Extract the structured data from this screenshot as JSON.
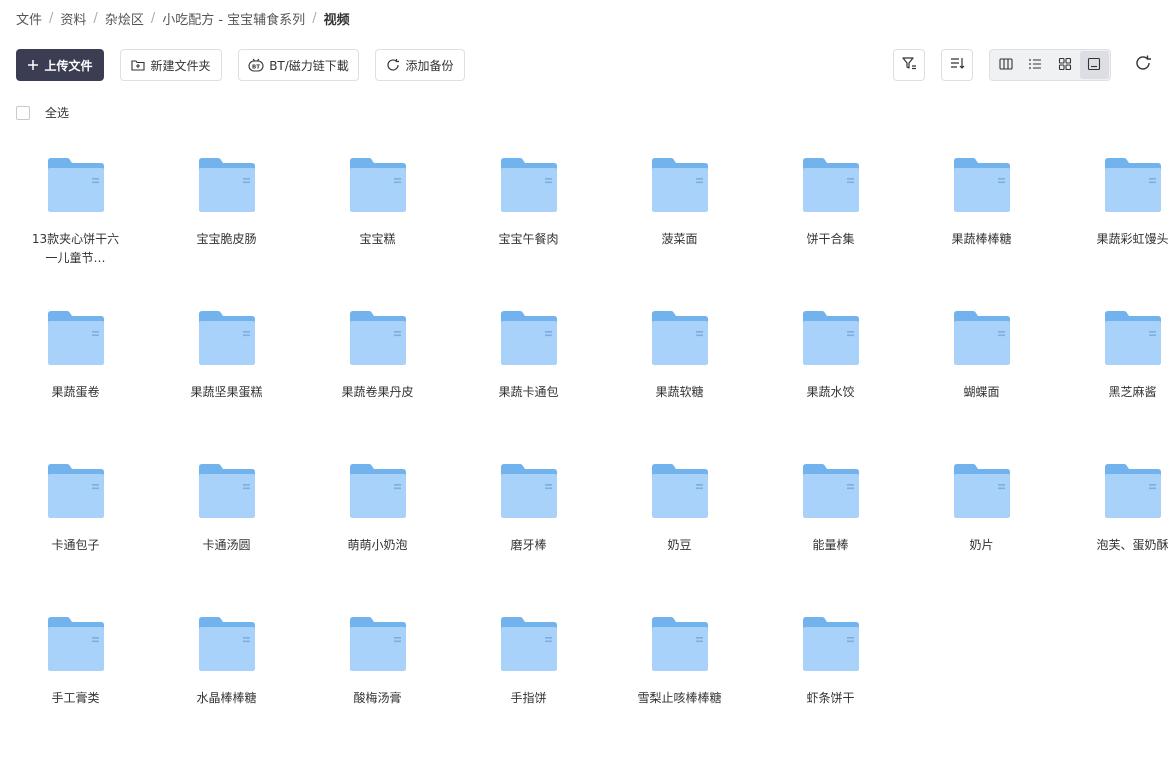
{
  "breadcrumb": [
    "文件",
    "资料",
    "杂烩区",
    "小吃配方 - 宝宝辅食系列",
    "视频"
  ],
  "toolbar": {
    "upload": "上传文件",
    "new_folder": "新建文件夹",
    "bt_download": "BT/磁力链下載",
    "add_backup": "添加备份"
  },
  "select_all": "全选",
  "colors": {
    "primary_button": "#3b3d52",
    "folder_back": "#72b3ee",
    "folder_front": "#a8d2f9",
    "folder_mark": "#7eaee0"
  },
  "icons": [
    "plus-icon",
    "new-folder-icon",
    "bt-icon",
    "refresh-icon",
    "filter-icon",
    "sort-icon",
    "column-view-icon",
    "list-view-icon",
    "grid-view-icon",
    "large-view-icon",
    "reload-icon",
    "folder-icon"
  ],
  "folders": [
    "13款夹心饼干六一儿童节…",
    "宝宝脆皮肠",
    "宝宝糕",
    "宝宝午餐肉",
    "菠菜面",
    "饼干合集",
    "果蔬棒棒糖",
    "果蔬彩虹馒头",
    "果蔬蛋卷",
    "果蔬坚果蛋糕",
    "果蔬卷果丹皮",
    "果蔬卡通包",
    "果蔬软糖",
    "果蔬水饺",
    "蝴蝶面",
    "黑芝麻酱",
    "卡通包子",
    "卡通汤圆",
    "萌萌小奶泡",
    "磨牙棒",
    "奶豆",
    "能量棒",
    "奶片",
    "泡芙、蛋奶酥",
    "手工膏类",
    "水晶棒棒糖",
    "酸梅汤膏",
    "手指饼",
    "雪梨止咳棒棒糖",
    "虾条饼干"
  ]
}
